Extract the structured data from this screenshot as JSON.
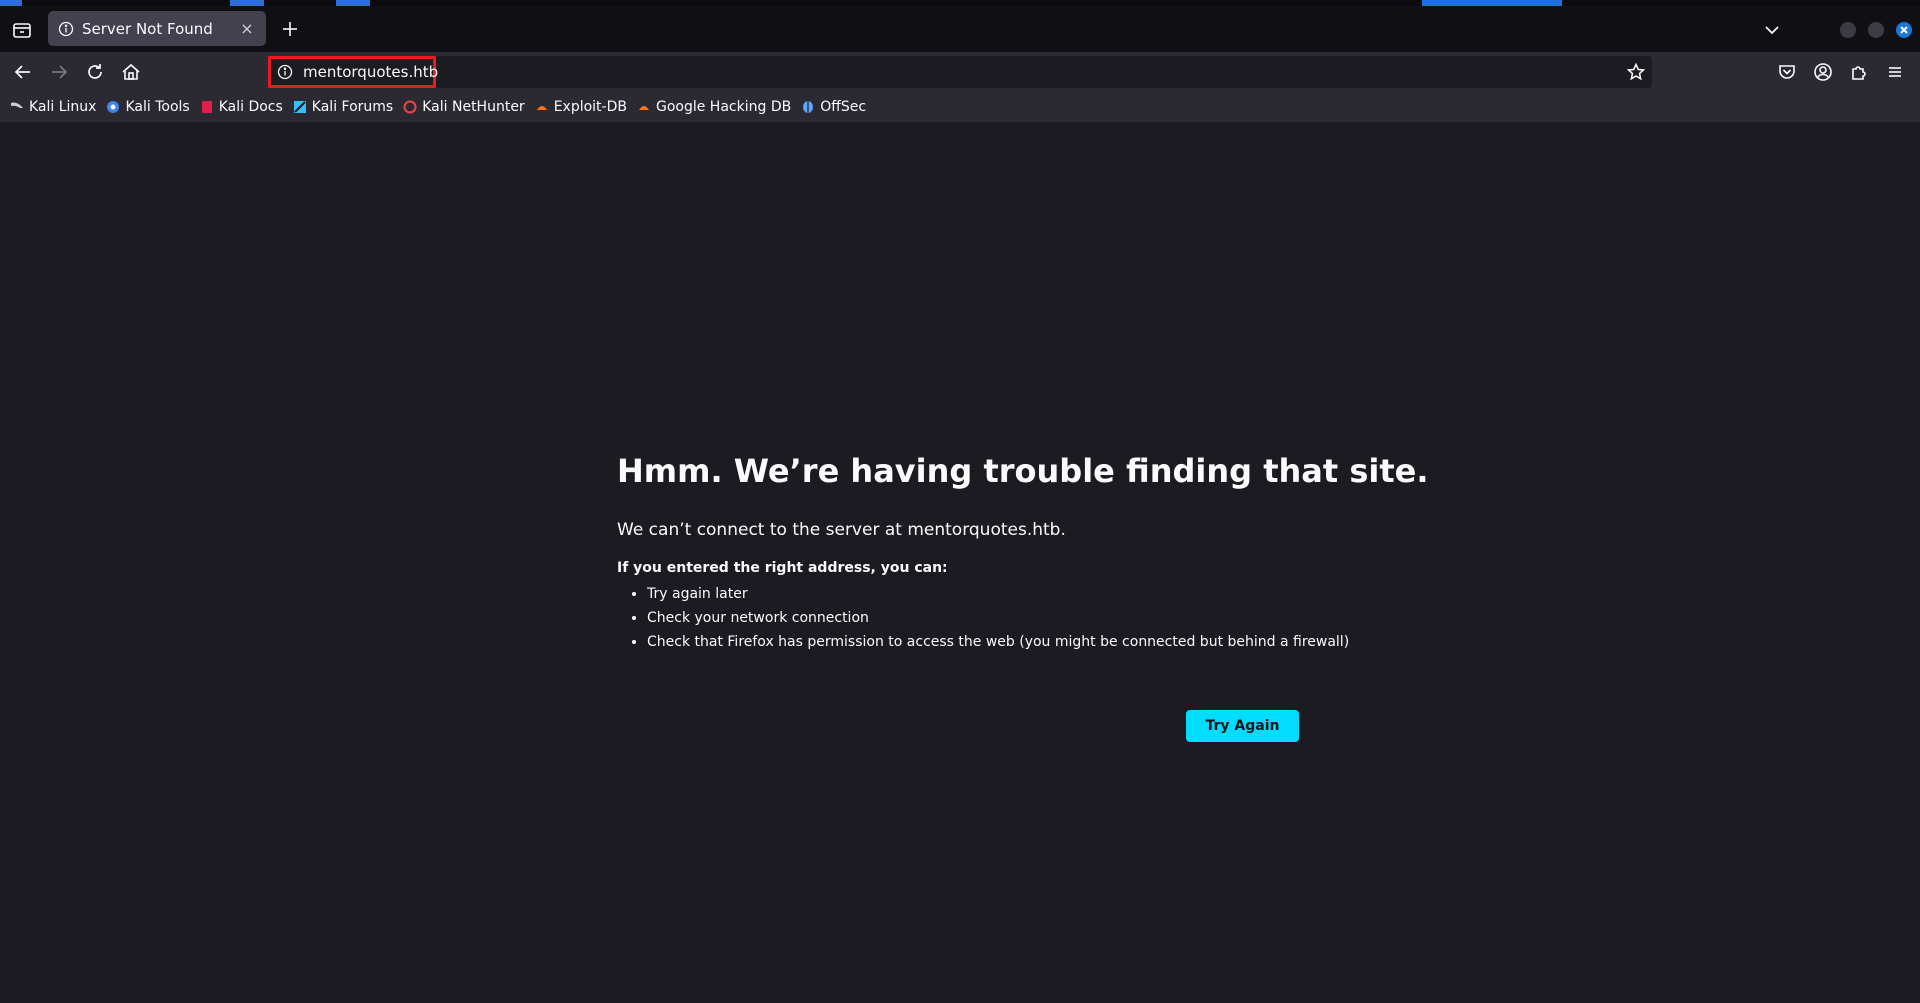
{
  "tab": {
    "title": "Server Not Found",
    "close_glyph": "×"
  },
  "urlbar": {
    "url": "mentorquotes.htb"
  },
  "bookmarks": [
    {
      "label": "Kali Linux",
      "icon": "kali-dragon-icon",
      "color": "#cfcfd8"
    },
    {
      "label": "Kali Tools",
      "icon": "kali-tools-icon",
      "color": "#3b82f6"
    },
    {
      "label": "Kali Docs",
      "icon": "kali-docs-icon",
      "color": "#e11d48"
    },
    {
      "label": "Kali Forums",
      "icon": "kali-forums-icon",
      "color": "#38bdf8"
    },
    {
      "label": "Kali NetHunter",
      "icon": "kali-nethunter-icon",
      "color": "#ef4444"
    },
    {
      "label": "Exploit-DB",
      "icon": "exploit-db-icon",
      "color": "#f97316"
    },
    {
      "label": "Google Hacking DB",
      "icon": "ghdb-icon",
      "color": "#f97316"
    },
    {
      "label": "OffSec",
      "icon": "offsec-icon",
      "color": "#60a5fa"
    }
  ],
  "error": {
    "title": "Hmm. We’re having trouble finding that site.",
    "description": "We can’t connect to the server at mentorquotes.htb.",
    "subheading": "If you entered the right address, you can:",
    "suggestions": [
      "Try again later",
      "Check your network connection",
      "Check that Firefox has permission to access the web (you might be connected but behind a firewall)"
    ],
    "button_label": "Try Again"
  },
  "colors": {
    "accent": "#00ddff",
    "highlight_border": "#e81b1b",
    "page_bg": "#1c1b22"
  }
}
